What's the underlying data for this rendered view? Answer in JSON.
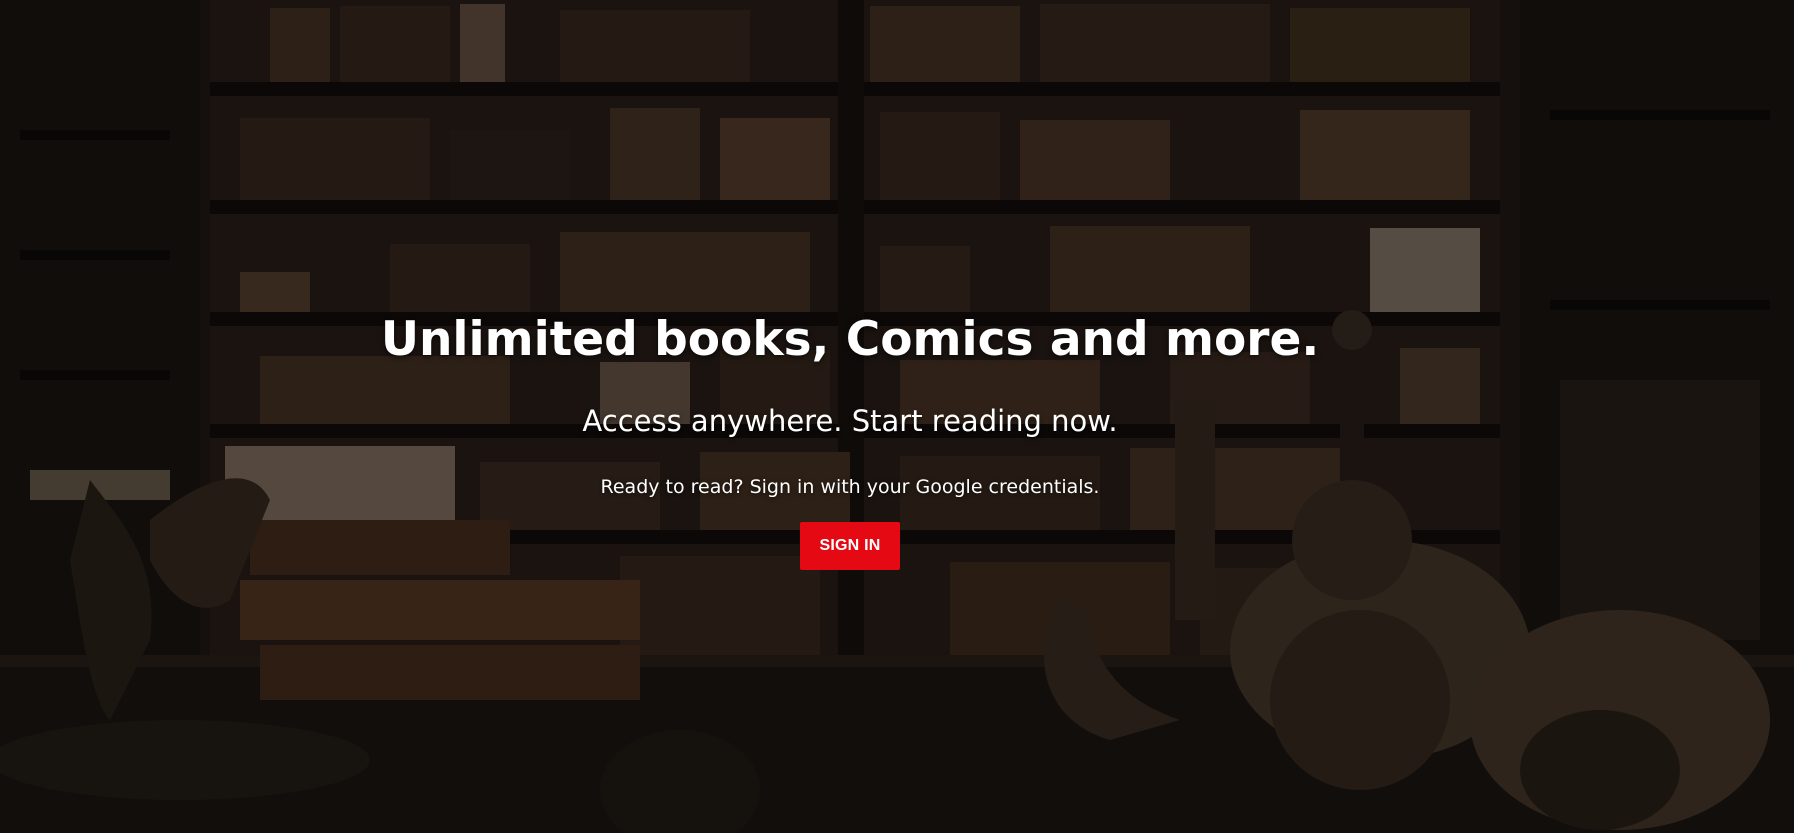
{
  "hero": {
    "headline": "Unlimited books, Comics and more.",
    "subheadline": "Access anywhere. Start reading now.",
    "prompt": "Ready to read? Sign in with your Google credentials.",
    "signin_label": "SIGN IN"
  },
  "colors": {
    "accent": "#e50914",
    "text": "#ffffff",
    "background": "#1a1512"
  },
  "background_image": "dark-library-bookshelves"
}
